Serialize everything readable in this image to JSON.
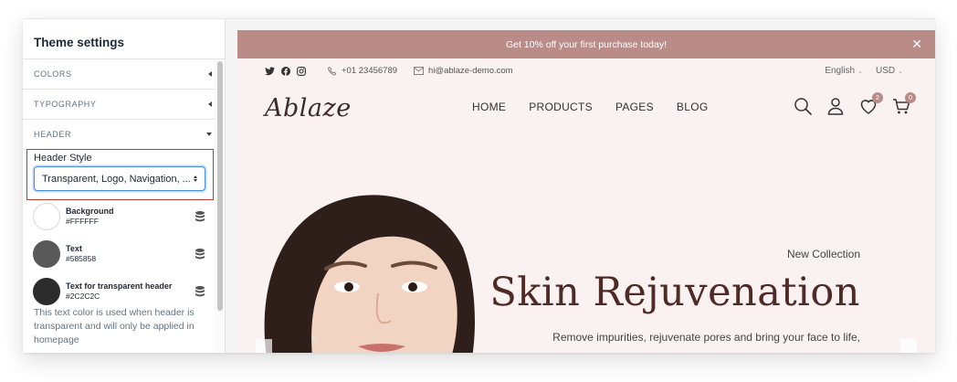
{
  "sidebar": {
    "title": "Theme settings",
    "sections": [
      {
        "label": "COLORS",
        "state": "collapsed"
      },
      {
        "label": "TYPOGRAPHY",
        "state": "collapsed"
      },
      {
        "label": "HEADER",
        "state": "expanded"
      }
    ],
    "header_style": {
      "label": "Header Style",
      "value": "Transparent, Logo, Navigation, ..."
    },
    "colors": [
      {
        "name": "Background",
        "hex": "#FFFFFF"
      },
      {
        "name": "Text",
        "hex": "#585858"
      },
      {
        "name": "Text for transparent header",
        "hex": "#2C2C2C"
      }
    ],
    "help_text": "This text color is used when header is transparent and will only be applied in homepage"
  },
  "store": {
    "announcement": {
      "text": "Get 10% off your first purchase today!",
      "close": "✕"
    },
    "topbar": {
      "phone": "+01 23456789",
      "email": "hi@ablaze-demo.com",
      "language": "English",
      "currency": "USD"
    },
    "logo": "Ablaze",
    "menu": [
      "HOME",
      "PRODUCTS",
      "PAGES",
      "BLOG"
    ],
    "wishlist_count": "2",
    "cart_count": "0",
    "hero": {
      "subtitle": "New Collection",
      "title": "Skin Rejuvenation",
      "description": "Remove impurities, rejuvenate pores and bring your face to life,"
    }
  },
  "colors": {
    "accent": "#b98c88",
    "store_bg": "#f9f2f1",
    "hero_title": "#4f2a26",
    "highlight": "#c0392b",
    "focus": "#4a90e2"
  }
}
